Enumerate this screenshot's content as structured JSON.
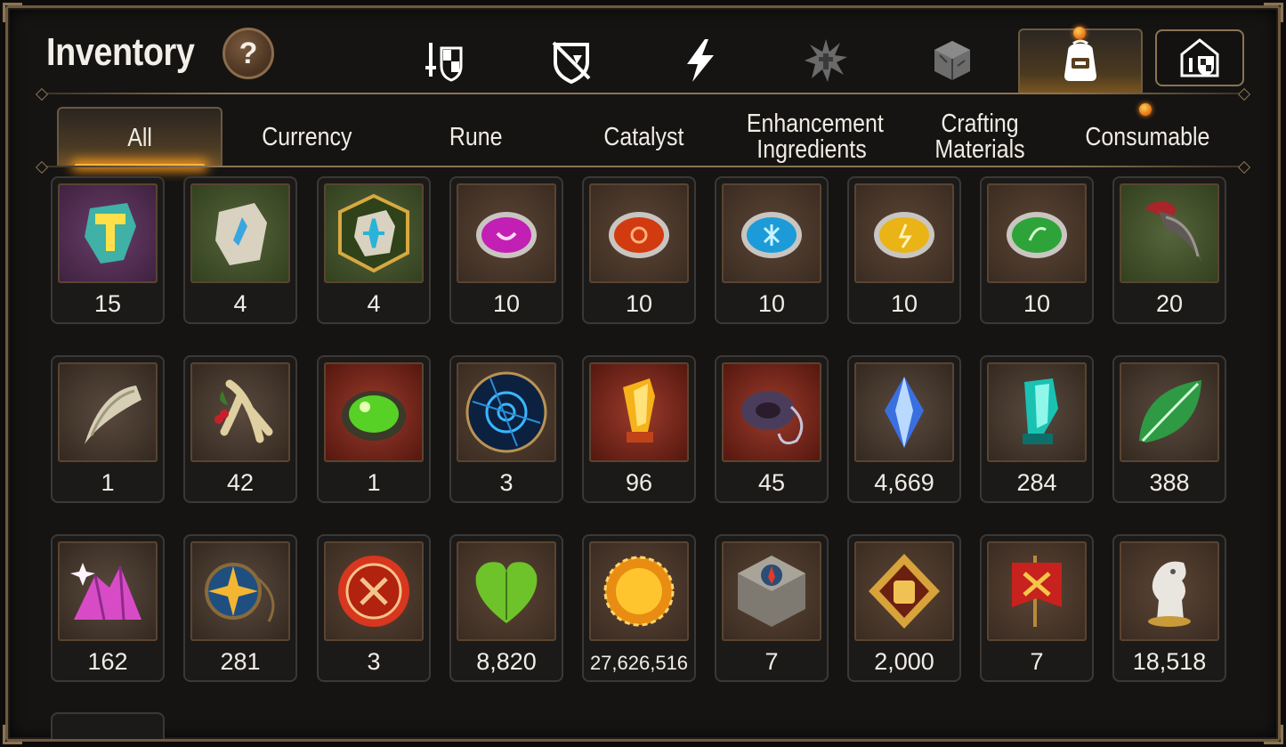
{
  "header": {
    "title": "Inventory",
    "help_label": "?"
  },
  "icon_tabs": [
    {
      "icon": "hero-gear-icon",
      "active": false
    },
    {
      "icon": "shield-broken-icon",
      "active": false
    },
    {
      "icon": "lightning-icon",
      "active": false
    },
    {
      "icon": "splatter-icon",
      "active": false
    },
    {
      "icon": "cube-icon",
      "active": false
    },
    {
      "icon": "backpack-icon",
      "active": true,
      "notification": true
    },
    {
      "icon": "guild-storage-icon",
      "active": false
    }
  ],
  "category_tabs": [
    {
      "label": "All",
      "active": true
    },
    {
      "label": "Currency",
      "active": false
    },
    {
      "label": "Rune",
      "active": false
    },
    {
      "label": "Catalyst",
      "active": false
    },
    {
      "label": "Enhancement Ingredients",
      "active": false
    },
    {
      "label": "Crafting Materials",
      "active": false
    },
    {
      "label": "Consumable",
      "active": false,
      "notification": true
    }
  ],
  "items": [
    {
      "icon": "hammer-stone-icon",
      "qty": "15"
    },
    {
      "icon": "rune-stone-icon",
      "qty": "4"
    },
    {
      "icon": "rune-stone-framed-icon",
      "qty": "4"
    },
    {
      "icon": "pink-gem-icon",
      "qty": "10"
    },
    {
      "icon": "red-gem-icon",
      "qty": "10"
    },
    {
      "icon": "blue-gem-icon",
      "qty": "10"
    },
    {
      "icon": "yellow-gem-icon",
      "qty": "10"
    },
    {
      "icon": "green-gem-icon",
      "qty": "10"
    },
    {
      "icon": "claw-icon",
      "qty": "20"
    },
    {
      "icon": "fang-icon",
      "qty": "1"
    },
    {
      "icon": "root-icon",
      "qty": "42"
    },
    {
      "icon": "green-orb-icon",
      "qty": "1"
    },
    {
      "icon": "portal-disc-icon",
      "qty": "3"
    },
    {
      "icon": "flame-crystal-icon",
      "qty": "96"
    },
    {
      "icon": "amulet-ring-icon",
      "qty": "45"
    },
    {
      "icon": "blue-crystal-icon",
      "qty": "4,669"
    },
    {
      "icon": "teal-crystal-icon",
      "qty": "284"
    },
    {
      "icon": "leaf-icon",
      "qty": "388"
    },
    {
      "icon": "pink-ore-icon",
      "qty": "162"
    },
    {
      "icon": "star-amulet-icon",
      "qty": "281"
    },
    {
      "icon": "red-seal-icon",
      "qty": "3"
    },
    {
      "icon": "green-heart-icon",
      "qty": "8,820"
    },
    {
      "icon": "gold-coin-icon",
      "qty": "27,626,516"
    },
    {
      "icon": "compass-stone-icon",
      "qty": "7"
    },
    {
      "icon": "fist-emblem-icon",
      "qty": "2,000"
    },
    {
      "icon": "banner-flag-icon",
      "qty": "7"
    },
    {
      "icon": "chess-knight-icon",
      "qty": "18,518"
    }
  ],
  "colors": {
    "frame_gold": "#8a7453",
    "active_glow": "#ff9a1a",
    "text": "#f1ede6"
  }
}
